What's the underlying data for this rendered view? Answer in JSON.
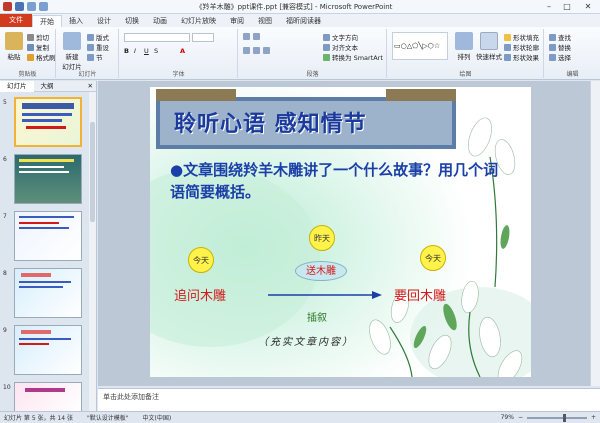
{
  "window": {
    "title": "《羚羊木雕》ppt课件.ppt [兼容模式] - Microsoft PowerPoint"
  },
  "tabs": [
    "文件",
    "开始",
    "插入",
    "设计",
    "切换",
    "动画",
    "幻灯片放映",
    "审阅",
    "视图",
    "福昕阅读器"
  ],
  "ribbon": {
    "clipboard": {
      "paste": "粘贴",
      "cut": "剪切",
      "copy": "复制",
      "format_painter": "格式刷",
      "label": "剪贴板"
    },
    "slides": {
      "new_slide": "新建\n幻灯片",
      "layout": "版式",
      "reset": "重设",
      "section": "节",
      "label": "幻灯片"
    },
    "font": {
      "label": "字体"
    },
    "paragraph": {
      "text_direction": "文字方向",
      "align_text": "对齐文本",
      "smartart": "转换为 SmartArt",
      "label": "段落"
    },
    "drawing": {
      "arrange": "排列",
      "quick_styles": "快速样式",
      "shape_fill": "形状填充",
      "shape_outline": "形状轮廓",
      "shape_effects": "形状效果",
      "label": "绘图"
    },
    "editing": {
      "find": "查找",
      "replace": "替换",
      "select": "选择",
      "label": "编辑"
    }
  },
  "left_pane": {
    "tabs": [
      "幻灯片",
      "大纲"
    ],
    "slide_numbers": [
      "5",
      "6",
      "7",
      "8",
      "9",
      "10"
    ]
  },
  "slide": {
    "title": "聆听心语  感知情节",
    "body": "●文章围绕羚羊木雕讲了一个什么故事？用几个词语简要概括。",
    "circle_left": "今天",
    "circle_mid": "昨天",
    "circle_right": "今天",
    "oval": "送木雕",
    "left_phrase": "追问木雕",
    "right_phrase": "要回木雕",
    "technique": "插叙",
    "note": "（充实文章内容）"
  },
  "notes": {
    "placeholder": "单击此处添加备注"
  },
  "status": {
    "slide_info": "幻灯片 第 5 张，共 14 张",
    "theme": "\"默认设计模板\"",
    "language": "中文(中国)",
    "zoom": "79%"
  },
  "colors": {
    "accent": "#d23c1e",
    "title_blue": "#1a3a9c",
    "red_text": "#d21a1a",
    "green_text": "#2c7a23"
  }
}
